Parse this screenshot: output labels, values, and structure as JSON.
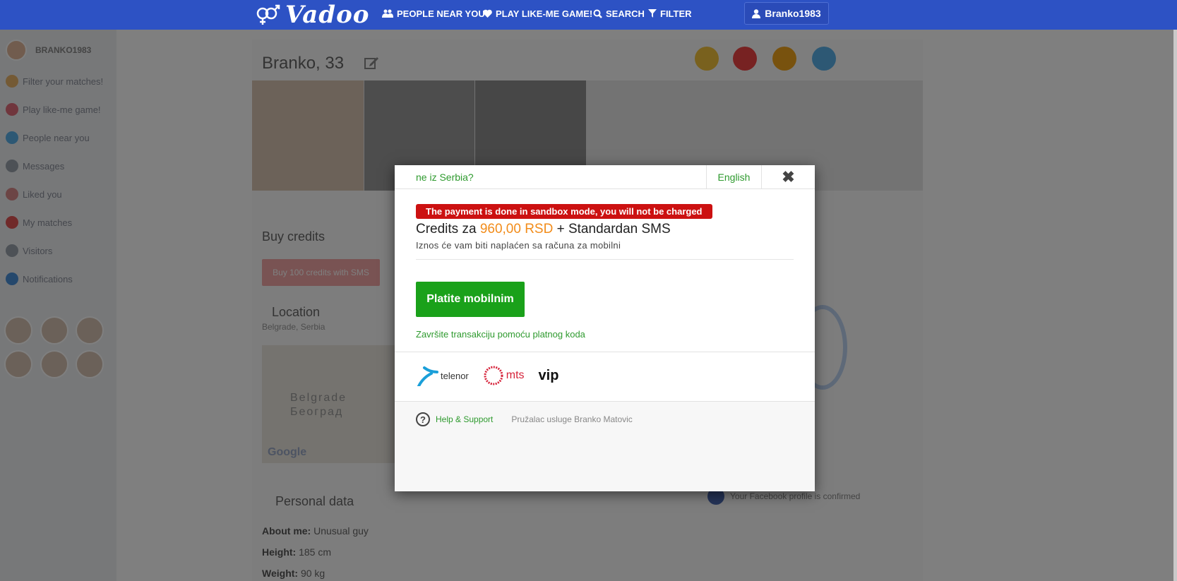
{
  "navbar": {
    "logo_text": "Vadoo",
    "links": [
      {
        "label": "PEOPLE NEAR YOU",
        "icon": "users-icon"
      },
      {
        "label": "PLAY LIKE-ME GAME!",
        "icon": "heart-icon"
      },
      {
        "label": "SEARCH",
        "icon": "search-icon"
      },
      {
        "label": "FILTER",
        "icon": "filter-icon"
      }
    ],
    "user_label": "Branko1983"
  },
  "sidebar": {
    "username": "BRANKO1983",
    "items": [
      {
        "label": "Filter your matches!",
        "color": "#e8b46a"
      },
      {
        "label": "Play like-me game!",
        "color": "#e06d7a"
      },
      {
        "label": "People near you",
        "color": "#5ab0e8"
      },
      {
        "label": "Messages",
        "color": "#9aa2ad"
      },
      {
        "label": "Liked you",
        "color": "#d98a8a"
      },
      {
        "label": "My matches",
        "color": "#e05555"
      },
      {
        "label": "Visitors",
        "color": "#9aa2ad"
      },
      {
        "label": "Notifications",
        "color": "#4a90d9"
      }
    ]
  },
  "profile": {
    "name_age": "Branko, 33",
    "buy_credits_title": "Buy credits",
    "buy_sms_button": "Buy 100 credits with SMS",
    "location_title": "Location",
    "location_value": "Belgrade, Serbia",
    "map_text_latin": "Belgrade",
    "map_text_cyr": "Београд",
    "map_google": "Google",
    "personal_title": "Personal data",
    "rows": [
      {
        "key": "About me:",
        "value": "Unusual guy"
      },
      {
        "key": "Height:",
        "value": "185 cm"
      },
      {
        "key": "Weight:",
        "value": "90 kg"
      }
    ],
    "facebook_note": "Your Facebook profile is confirmed"
  },
  "modal": {
    "country_link": "ne iz Serbia?",
    "language": "English",
    "close_symbol": "✖",
    "sandbox_notice": "The payment is done in sandbox mode, you will not be charged",
    "credits_prefix": "Credits za ",
    "credits_price": "960,00 RSD",
    "credits_suffix": " + Standardan SMS",
    "credits_sub": "Iznos će vam biti naplaćen sa računa za mobilni",
    "pay_button": "Platite mobilnim",
    "code_link": "Završite transakciju pomoću platnog koda",
    "operators": [
      "telenor",
      "mts",
      "vip"
    ],
    "help_link": "Help & Support",
    "provider": "Pružalac usluge Branko Matovic"
  },
  "colors": {
    "navbar": "#2d52c4",
    "green": "#2e9a2e",
    "pay_button": "#1aa11a",
    "sandbox_red": "#cc1111",
    "price_orange": "#f28c1a"
  }
}
